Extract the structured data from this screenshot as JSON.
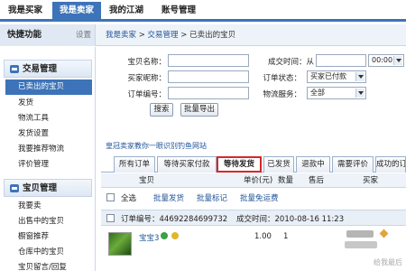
{
  "topnav": {
    "tabs": [
      {
        "label": "我是买家",
        "active": false
      },
      {
        "label": "我是卖家",
        "active": true
      },
      {
        "label": "我的江湖",
        "active": false
      },
      {
        "label": "账号管理",
        "active": false
      }
    ]
  },
  "quickbar": {
    "title": "快捷功能",
    "setting_label": "设置"
  },
  "breadcrumb": {
    "part1": "我是卖家",
    "sep1": " > ",
    "part2": "交易管理",
    "sep2": " > ",
    "current": "已卖出的宝贝"
  },
  "sidebar": {
    "sections": [
      {
        "title": "交易管理",
        "items": [
          "已卖出的宝贝",
          "发货",
          "物流工具",
          "发货设置",
          "我要推荐物流",
          "评价管理"
        ]
      },
      {
        "title": "宝贝管理",
        "items": [
          "我要卖",
          "出售中的宝贝",
          "橱窗推荐",
          "仓库中的宝贝",
          "宝贝留言/回复"
        ]
      }
    ],
    "active_item": "已卖出的宝贝"
  },
  "search_form": {
    "item_name_label": "宝贝名称：",
    "item_name_value": "",
    "buyer_nick_label": "买家昵称：",
    "buyer_nick_value": "",
    "order_no_label": "订单编号：",
    "order_no_value": "",
    "deal_time_label": "成交时间：从",
    "deal_time_from": "",
    "deal_time_hour": "00:00",
    "order_status_label": "订单状态：",
    "order_status_value": "买家已付款",
    "logistics_label": "物流服务：",
    "logistics_value": "全部",
    "search_button": "搜索",
    "export_button": "批量导出"
  },
  "ad_link": "皇冠卖家教你一眼识别钓鱼网站",
  "order_tabs": [
    {
      "label": "所有订单",
      "highlight": false
    },
    {
      "label": "等待买家付款",
      "highlight": false
    },
    {
      "label": "等待发货",
      "highlight": true
    },
    {
      "label": "已发货",
      "highlight": false
    },
    {
      "label": "退款中",
      "highlight": false
    },
    {
      "label": "需要评价",
      "highlight": false
    },
    {
      "label": "成功的订",
      "highlight": false
    }
  ],
  "table": {
    "columns": [
      "宝贝",
      "单价(元)",
      "数量",
      "售后",
      "买家"
    ],
    "bulk": {
      "select_all": "全选",
      "batch_ship": "批量发货",
      "batch_remark": "批量标记",
      "batch_free_shipping": "批量免运费"
    },
    "order": {
      "order_no_label": "订单编号：44692284699732",
      "deal_time_label": "成交时间：2010-08-16 11:23",
      "item_title": "宝宝3",
      "unit_price": "1.00",
      "quantity": "1"
    }
  },
  "watermark": "给我最后"
}
